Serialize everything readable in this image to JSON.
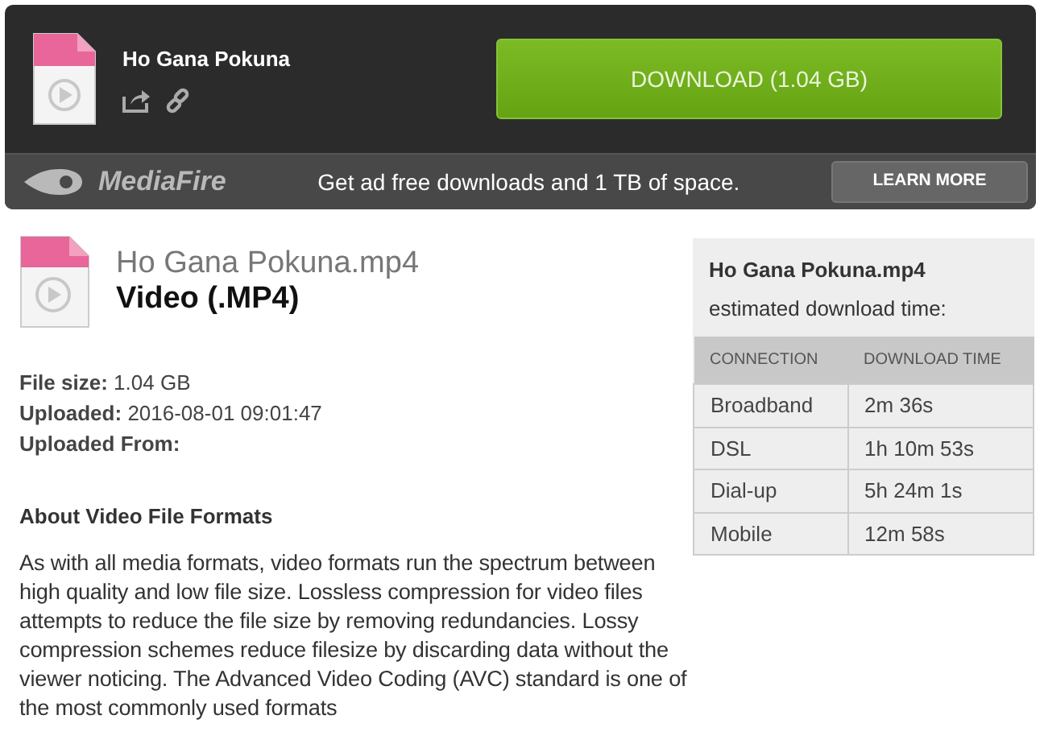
{
  "header": {
    "file_name": "Ho Gana Pokuna",
    "download_button": "DOWNLOAD (1.04 GB)"
  },
  "promo_bar": {
    "logo_text": "MediaFire",
    "message": "Get ad free downloads and 1 TB of space.",
    "button": "LEARN MORE"
  },
  "file_info": {
    "file_name": "Ho Gana Pokuna.mp4",
    "file_type": "Video (.MP4)",
    "details": [
      {
        "label": "File size:",
        "value": "1.04 GB"
      },
      {
        "label": "Uploaded:",
        "value": "2016-08-01 09:01:47"
      },
      {
        "label": "Uploaded From:"
      }
    ],
    "about_title": "About Video File Formats",
    "about_text": "As with all media formats, video formats run the spectrum between high quality and low file size. Lossless compression for video files attempts to reduce the file size by removing redundancies. Lossy compression schemes reduce filesize by discarding data without the viewer noticing. The Advanced Video Coding (AVC) standard is one of the most commonly used formats"
  },
  "download_time": {
    "file_name": "Ho Gana Pokuna.mp4",
    "subtitle": "estimated download time:",
    "columns": [
      "CONNECTION",
      "DOWNLOAD TIME"
    ],
    "rows": [
      [
        "Broadband",
        "2m 36s"
      ],
      [
        "DSL",
        "1h 10m 53s"
      ],
      [
        "Dial-up",
        "5h 24m 1s"
      ],
      [
        "Mobile",
        "12m 58s"
      ]
    ]
  }
}
